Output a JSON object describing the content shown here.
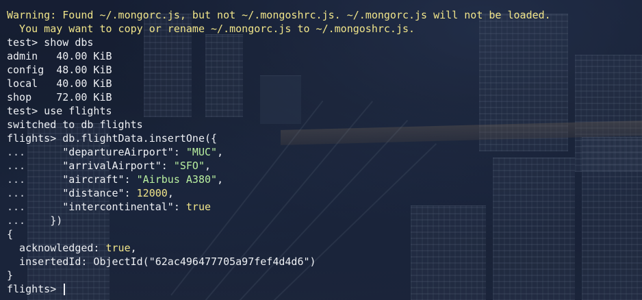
{
  "terminal": {
    "warning_line1": "Warning: Found ~/.mongorc.js, but not ~/.mongoshrc.js. ~/.mongorc.js will not be loaded.",
    "warning_line2": "  You may want to copy or rename ~/.mongorc.js to ~/.mongoshrc.js.",
    "cmd_show_dbs": "test> show dbs",
    "dbs": [
      {
        "name": "admin ",
        "size": "40.00 KiB"
      },
      {
        "name": "config",
        "size": "48.00 KiB"
      },
      {
        "name": "local ",
        "size": "40.00 KiB"
      },
      {
        "name": "shop  ",
        "size": "72.00 KiB"
      }
    ],
    "cmd_use": "test> use flights",
    "switched": "switched to db flights",
    "cmd_insert": "flights> db.flightData.insertOne({",
    "continuation": "...",
    "fields": [
      {
        "key": "\"departureAirport\"",
        "value": "\"MUC\"",
        "type": "str",
        "comma": ","
      },
      {
        "key": "\"arrivalAirport\"",
        "value": "\"SFO\"",
        "type": "str",
        "comma": ","
      },
      {
        "key": "\"aircraft\"",
        "value": "\"Airbus A380\"",
        "type": "str",
        "comma": ","
      },
      {
        "key": "\"distance\"",
        "value": "12000",
        "type": "num",
        "comma": ","
      },
      {
        "key": "\"intercontinental\"",
        "value": "true",
        "type": "bool",
        "comma": ""
      }
    ],
    "close_call": "})",
    "result_open": "{",
    "ack_key": "  acknowledged: ",
    "ack_value": "true",
    "ack_comma": ",",
    "inserted_line": "  insertedId: ObjectId(\"62ac496477705a97fef4d4d6\")",
    "result_close": "}",
    "prompt": "flights> "
  },
  "colors": {
    "warning": "#f1e58a",
    "string": "#b9f0a0",
    "number": "#f1e58a",
    "text": "#eef0f4"
  }
}
